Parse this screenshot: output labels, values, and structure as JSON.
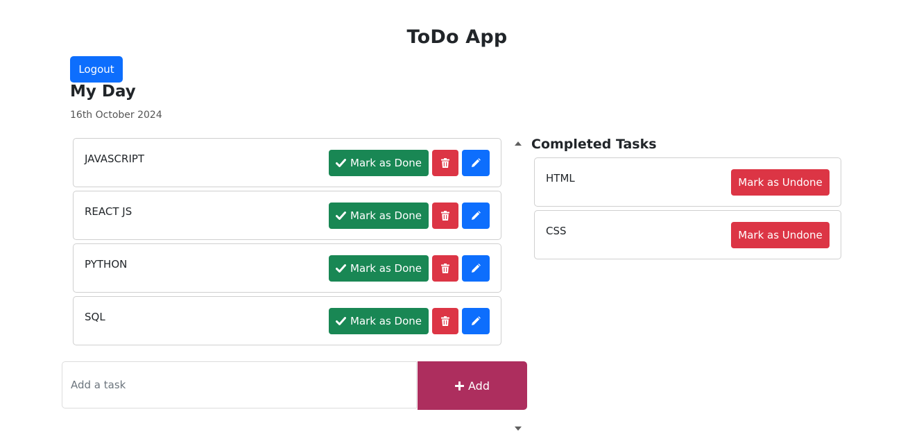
{
  "app": {
    "title": "ToDo App"
  },
  "header": {
    "logout_label": "Logout"
  },
  "day": {
    "heading": "My Day",
    "date": "16th October 2024"
  },
  "tasks": [
    {
      "name": "JAVASCRIPT",
      "done_label": "Mark as Done"
    },
    {
      "name": "REACT JS",
      "done_label": "Mark as Done"
    },
    {
      "name": "PYTHON",
      "done_label": "Mark as Done"
    },
    {
      "name": "SQL",
      "done_label": "Mark as Done"
    }
  ],
  "completed": {
    "heading": "Completed Tasks",
    "items": [
      {
        "name": "HTML",
        "undone_label": "Mark as Undone"
      },
      {
        "name": "CSS",
        "undone_label": "Mark as Undone"
      }
    ]
  },
  "add": {
    "placeholder": "Add a task",
    "value": "",
    "button_label": "Add"
  },
  "icons": {
    "done": "check-icon",
    "delete": "trash-icon",
    "edit": "pencil-icon",
    "add": "plus-icon"
  },
  "colors": {
    "primary": "#0d6efd",
    "success": "#198754",
    "danger": "#dc3545",
    "add_button": "#ad2e5e"
  }
}
